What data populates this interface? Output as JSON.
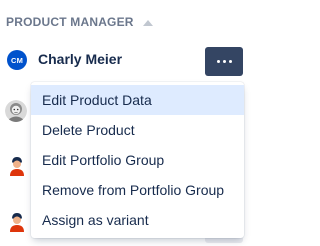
{
  "column_header": {
    "label": "PRODUCT MANAGER",
    "sort_icon": "sort-ascending-icon"
  },
  "rows": [
    {
      "avatar_type": "initials",
      "initials": "CM",
      "avatar_color": "#0052cc",
      "name": "Charly Meier",
      "has_more_button": true
    },
    {
      "avatar_type": "photo",
      "icon": "user-photo-icon",
      "name": ""
    },
    {
      "avatar_type": "illustration",
      "icon": "user-avatar-icon",
      "name": ""
    },
    {
      "avatar_type": "illustration",
      "icon": "user-avatar-icon",
      "name": ""
    }
  ],
  "more_button": {
    "icon": "more-horizontal-icon",
    "color": "#344563"
  },
  "menu": {
    "items": [
      {
        "label": "Edit Product Data",
        "active": true
      },
      {
        "label": "Delete Product",
        "active": false
      },
      {
        "label": "Edit Portfolio Group",
        "active": false
      },
      {
        "label": "Remove from Portfolio Group",
        "active": false
      },
      {
        "label": "Assign as variant",
        "active": false
      }
    ],
    "active_color": "#deebff"
  }
}
